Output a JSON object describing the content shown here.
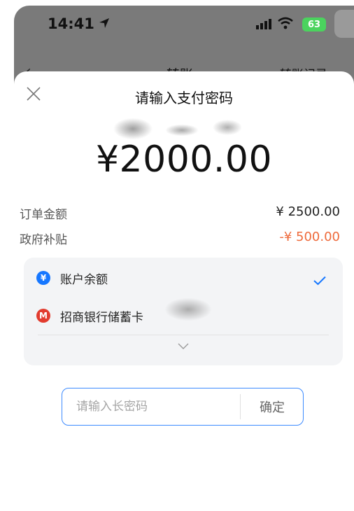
{
  "status_bar": {
    "time": "14:41",
    "battery": "63"
  },
  "background_nav": {
    "title": "转账",
    "right_link": "转账记录"
  },
  "sheet": {
    "title": "请输入支付密码",
    "amount": "¥2000.00",
    "rows": [
      {
        "label": "订单金额",
        "value": "¥ 2500.00"
      },
      {
        "label": "政府补贴",
        "value": "-¥ 500.00"
      }
    ],
    "payment_methods": [
      {
        "icon": "yuan-circle-icon",
        "label": "账户余额",
        "selected": true
      },
      {
        "icon": "cmb-bank-icon",
        "label": "招商银行储蓄卡",
        "selected": false
      }
    ],
    "password": {
      "placeholder": "请输入长密码",
      "value": "",
      "confirm_label": "确定"
    }
  },
  "colors": {
    "accent": "#1677ff",
    "discount": "#ee6a3b",
    "bank": "#e23b2e",
    "input_border": "#3d8bff"
  }
}
